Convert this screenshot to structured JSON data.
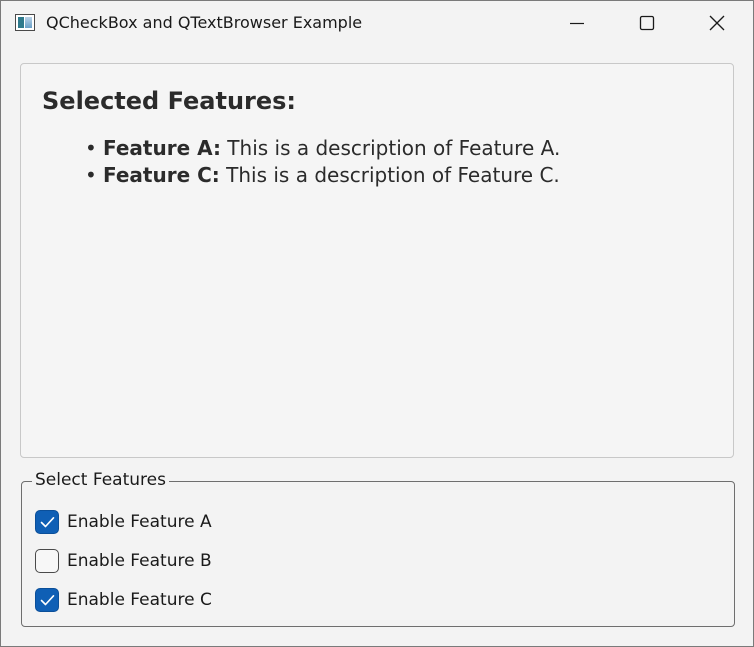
{
  "window": {
    "title": "QCheckBox and QTextBrowser Example",
    "icon": "app-window-icon",
    "controls": [
      "minimize-icon",
      "maximize-icon",
      "close-icon"
    ]
  },
  "browser": {
    "heading": "Selected Features:",
    "items": [
      {
        "bullet": "•",
        "name": "Feature A:",
        "description": " This is a description of Feature A."
      },
      {
        "bullet": "•",
        "name": "Feature C:",
        "description": " This is a description of Feature C."
      }
    ]
  },
  "group": {
    "title": "Select Features",
    "checkboxes": [
      {
        "label": "Enable Feature A",
        "checked": true
      },
      {
        "label": "Enable Feature B",
        "checked": false
      },
      {
        "label": "Enable Feature C",
        "checked": true
      }
    ]
  },
  "colors": {
    "checked_fill": "#0f5fb5",
    "window_bg": "#f3f3f3"
  }
}
